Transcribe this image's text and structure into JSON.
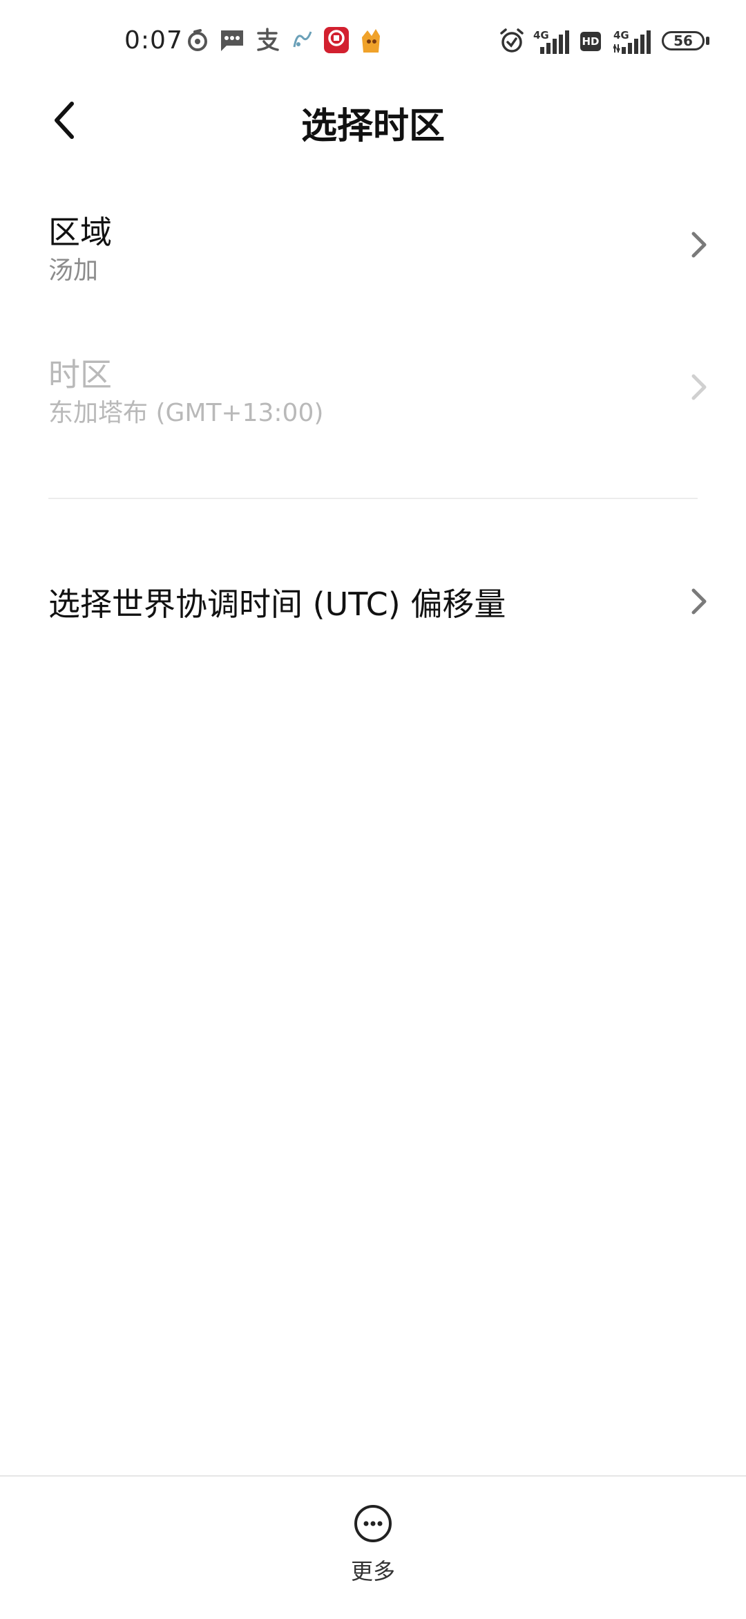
{
  "status_bar": {
    "time": "0:07",
    "battery": "56",
    "network_1": "4G",
    "network_2": "4G",
    "hd": "HD",
    "icons": [
      "netease-icon",
      "message-icon",
      "alipay-icon",
      "app-icon",
      "bank-app-icon",
      "game-app-icon"
    ]
  },
  "header": {
    "title": "选择时区"
  },
  "rows": [
    {
      "title": "区域",
      "subtitle": "汤加",
      "enabled": true
    },
    {
      "title": "时区",
      "subtitle": "东加塔布 (GMT+13:00)",
      "enabled": false
    }
  ],
  "utc": {
    "label": "选择世界协调时间 (UTC) 偏移量"
  },
  "bottom": {
    "more_label": "更多"
  },
  "colors": {
    "background": "#ffffff",
    "primary_text": "#111111",
    "secondary_text": "#8c8c8c",
    "disabled_text": "#b9b9b9",
    "divider": "#ececec"
  }
}
